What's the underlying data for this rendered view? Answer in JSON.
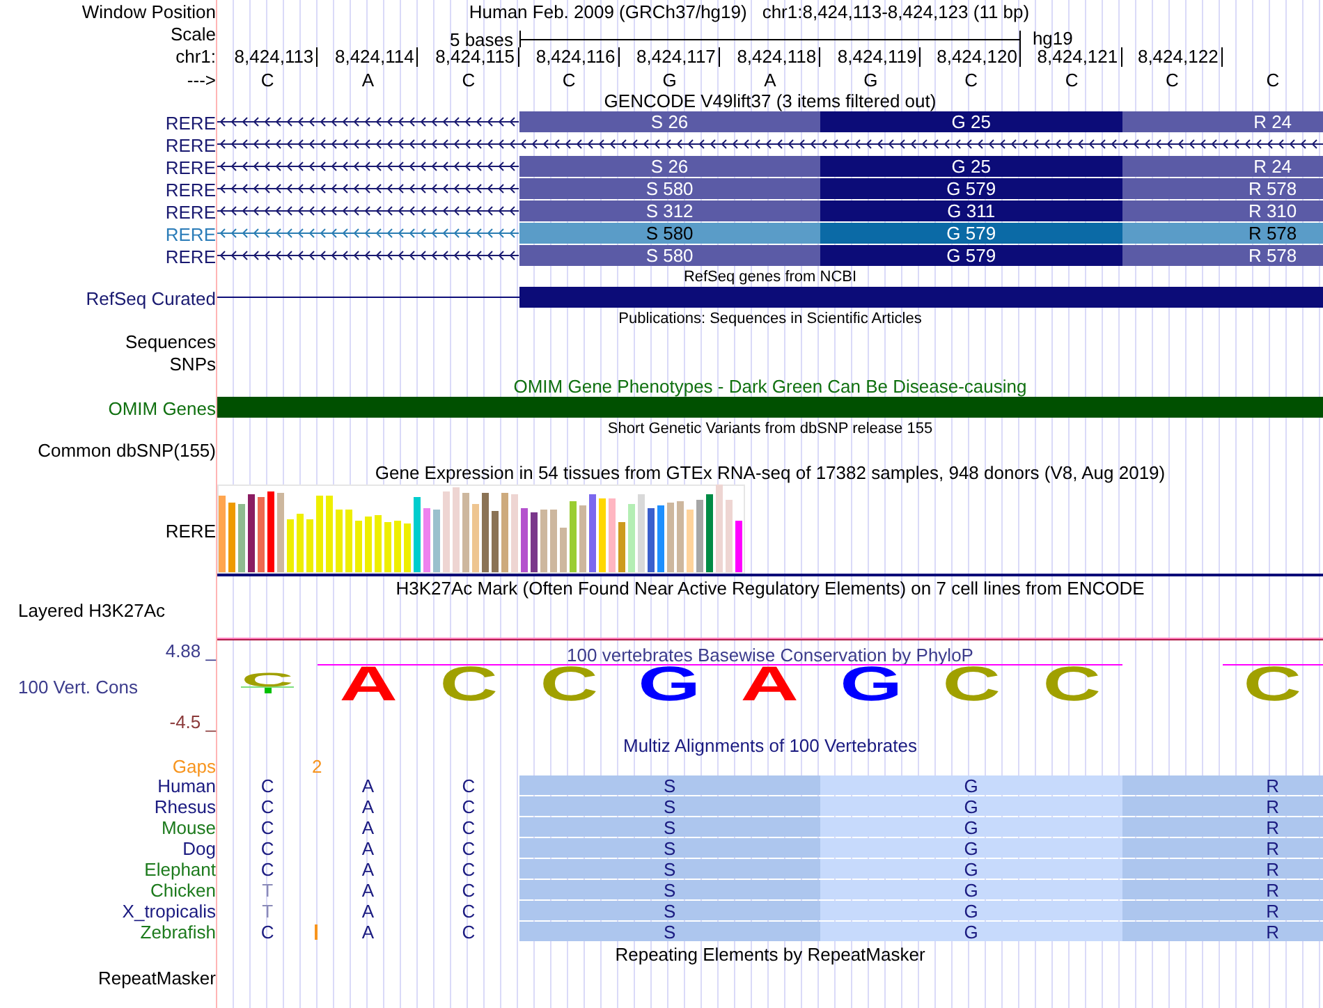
{
  "position": {
    "label": "Window Position",
    "assembly": "Human Feb. 2009 (GRCh37/hg19)",
    "range": "chr1:8,424,113-8,424,123 (11 bp)"
  },
  "scale": {
    "label": "Scale",
    "span": "5 bases",
    "assembly": "hg19"
  },
  "coordinates": {
    "label": "chr1:",
    "positions": [
      "8,424,113",
      "8,424,114",
      "8,424,115",
      "8,424,116",
      "8,424,117",
      "8,424,118",
      "8,424,119",
      "8,424,120",
      "8,424,121",
      "8,424,122"
    ]
  },
  "strand": {
    "label": "--->",
    "bases": [
      "C",
      "A",
      "C",
      "C",
      "G",
      "A",
      "G",
      "C",
      "C",
      "C",
      "C"
    ]
  },
  "gencode": {
    "title": "GENCODE V49lift37 (3 items filtered out)",
    "transcripts": [
      {
        "name": "RERE",
        "highlighted": false,
        "kind": "exon",
        "segments": [
          {
            "text": "S 26",
            "dark": false
          },
          {
            "text": "G 25",
            "dark": true
          },
          {
            "text": "R 24",
            "dark": false
          }
        ]
      },
      {
        "name": "RERE",
        "highlighted": false,
        "kind": "intron"
      },
      {
        "name": "RERE",
        "highlighted": false,
        "kind": "exon",
        "segments": [
          {
            "text": "S 26",
            "dark": false
          },
          {
            "text": "G 25",
            "dark": true
          },
          {
            "text": "R 24",
            "dark": false
          }
        ]
      },
      {
        "name": "RERE",
        "highlighted": false,
        "kind": "exon",
        "segments": [
          {
            "text": "S 580",
            "dark": false
          },
          {
            "text": "G 579",
            "dark": true
          },
          {
            "text": "R 578",
            "dark": false
          }
        ]
      },
      {
        "name": "RERE",
        "highlighted": false,
        "kind": "exon",
        "segments": [
          {
            "text": "S 312",
            "dark": false
          },
          {
            "text": "G 311",
            "dark": true
          },
          {
            "text": "R 310",
            "dark": false
          }
        ]
      },
      {
        "name": "RERE",
        "highlighted": true,
        "kind": "exon",
        "segments": [
          {
            "text": "S 580",
            "dark": false
          },
          {
            "text": "G 579",
            "dark": true
          },
          {
            "text": "R 578",
            "dark": false
          }
        ]
      },
      {
        "name": "RERE",
        "highlighted": false,
        "kind": "exon",
        "segments": [
          {
            "text": "S 580",
            "dark": false
          },
          {
            "text": "G 579",
            "dark": true
          },
          {
            "text": "R 578",
            "dark": false
          }
        ]
      }
    ]
  },
  "refseq": {
    "title": "RefSeq genes from NCBI",
    "label": "RefSeq Curated"
  },
  "publications": {
    "title": "Publications: Sequences in Scientific Articles",
    "labels": [
      "Sequences",
      "SNPs"
    ]
  },
  "omim": {
    "title": "OMIM Gene Phenotypes - Dark Green Can Be Disease-causing",
    "label": "OMIM Genes"
  },
  "dbsnp": {
    "title": "Short Genetic Variants from dbSNP release 155",
    "label": "Common dbSNP(155)"
  },
  "gtex": {
    "title": "Gene Expression in 54 tissues from GTEx RNA-seq of 17382 samples, 948 donors (V8, Aug 2019)",
    "label": "RERE"
  },
  "h3k27ac": {
    "title": "H3K27Ac Mark (Often Found Near Active Regulatory Elements) on 7 cell lines from ENCODE",
    "label": "Layered H3K27Ac"
  },
  "conservation": {
    "max": "4.88 _",
    "label": "100 Vert. Cons",
    "min": "-4.5 _",
    "title": "100 vertebrates Basewise Conservation by PhyloP",
    "columns": [
      {
        "kind": "short",
        "base": "C",
        "color": "#a0a000"
      },
      {
        "kind": "tall",
        "base": "A",
        "color": "#ff0000"
      },
      {
        "kind": "tall",
        "base": "C",
        "color": "#a0a000"
      },
      {
        "kind": "tall",
        "base": "C",
        "color": "#a0a000"
      },
      {
        "kind": "tall",
        "base": "G",
        "color": "#0000ff"
      },
      {
        "kind": "tall",
        "base": "A",
        "color": "#ff0000"
      },
      {
        "kind": "tall",
        "base": "G",
        "color": "#0000ff"
      },
      {
        "kind": "tall",
        "base": "C",
        "color": "#a0a000"
      },
      {
        "kind": "tall",
        "base": "C",
        "color": "#a0a000"
      },
      {
        "kind": "gap"
      },
      {
        "kind": "tall",
        "base": "C",
        "color": "#a0a000"
      }
    ]
  },
  "multiz": {
    "title": "Multiz Alignments of 100 Vertebrates",
    "gaps": {
      "label": "Gaps",
      "count": "2"
    },
    "species": [
      {
        "name": "Human",
        "color": "#1a1a80",
        "insertion": false,
        "bases": [
          {
            "base": "C",
            "faded": false
          },
          {
            "base": "A",
            "faded": false
          },
          {
            "base": "C",
            "faded": false
          }
        ],
        "blocks": [
          {
            "text": "S",
            "dark": true
          },
          {
            "text": "G",
            "dark": false
          },
          {
            "text": "R",
            "dark": true
          }
        ]
      },
      {
        "name": "Rhesus",
        "color": "#1a1a80",
        "insertion": false,
        "bases": [
          {
            "base": "C",
            "faded": false
          },
          {
            "base": "A",
            "faded": false
          },
          {
            "base": "C",
            "faded": false
          }
        ],
        "blocks": [
          {
            "text": "S",
            "dark": true
          },
          {
            "text": "G",
            "dark": false
          },
          {
            "text": "R",
            "dark": true
          }
        ]
      },
      {
        "name": "Mouse",
        "color": "#1c7a1c",
        "insertion": false,
        "bases": [
          {
            "base": "C",
            "faded": false
          },
          {
            "base": "A",
            "faded": false
          },
          {
            "base": "C",
            "faded": false
          }
        ],
        "blocks": [
          {
            "text": "S",
            "dark": true
          },
          {
            "text": "G",
            "dark": false
          },
          {
            "text": "R",
            "dark": true
          }
        ]
      },
      {
        "name": "Dog",
        "color": "#1a1a80",
        "insertion": false,
        "bases": [
          {
            "base": "C",
            "faded": false
          },
          {
            "base": "A",
            "faded": false
          },
          {
            "base": "C",
            "faded": false
          }
        ],
        "blocks": [
          {
            "text": "S",
            "dark": true
          },
          {
            "text": "G",
            "dark": false
          },
          {
            "text": "R",
            "dark": true
          }
        ]
      },
      {
        "name": "Elephant",
        "color": "#1c7a1c",
        "insertion": false,
        "bases": [
          {
            "base": "C",
            "faded": false
          },
          {
            "base": "A",
            "faded": false
          },
          {
            "base": "C",
            "faded": false
          }
        ],
        "blocks": [
          {
            "text": "S",
            "dark": true
          },
          {
            "text": "G",
            "dark": false
          },
          {
            "text": "R",
            "dark": true
          }
        ]
      },
      {
        "name": "Chicken",
        "color": "#1c7a1c",
        "insertion": false,
        "bases": [
          {
            "base": "T",
            "faded": true
          },
          {
            "base": "A",
            "faded": false
          },
          {
            "base": "C",
            "faded": false
          }
        ],
        "blocks": [
          {
            "text": "S",
            "dark": true
          },
          {
            "text": "G",
            "dark": false
          },
          {
            "text": "R",
            "dark": true
          }
        ]
      },
      {
        "name": "X_tropicalis",
        "color": "#1a1a80",
        "insertion": false,
        "bases": [
          {
            "base": "T",
            "faded": true
          },
          {
            "base": "A",
            "faded": false
          },
          {
            "base": "C",
            "faded": false
          }
        ],
        "blocks": [
          {
            "text": "S",
            "dark": true
          },
          {
            "text": "G",
            "dark": false
          },
          {
            "text": "R",
            "dark": true
          }
        ]
      },
      {
        "name": "Zebrafish",
        "color": "#1c7a1c",
        "insertion": true,
        "bases": [
          {
            "base": "C",
            "faded": false
          },
          {
            "base": "A",
            "faded": false
          },
          {
            "base": "C",
            "faded": false
          }
        ],
        "blocks": [
          {
            "text": "S",
            "dark": true
          },
          {
            "text": "G",
            "dark": false
          },
          {
            "text": "R",
            "dark": true
          }
        ]
      }
    ]
  },
  "repeatmasker": {
    "title": "Repeating Elements by RepeatMasker",
    "label": "RepeatMasker"
  }
}
